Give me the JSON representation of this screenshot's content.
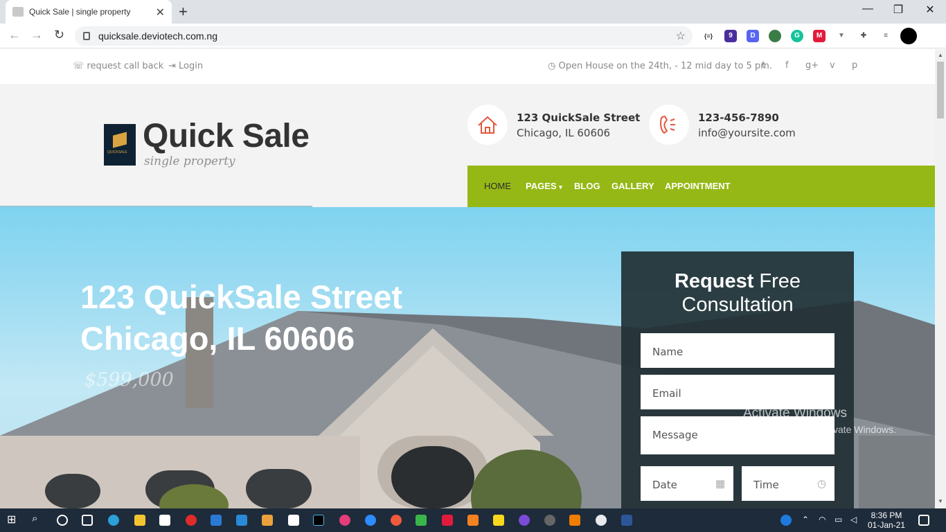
{
  "browser": {
    "tab_title": "Quick Sale | single property",
    "url": "quicksale.deviotech.com.ng",
    "extension_badge": "9"
  },
  "topbar": {
    "callback": "request call back",
    "login": "Login",
    "open_house": "Open House on the 24th, - 12 mid day to 5 pm.",
    "social": [
      "twitter-icon",
      "facebook-icon",
      "google-plus-icon",
      "vimeo-icon",
      "pinterest-icon"
    ],
    "social_glyphs": [
      "t",
      "f",
      "g+",
      "v",
      "p"
    ]
  },
  "header": {
    "logo_small": "QUICKSALE",
    "title": "Quick Sale",
    "tagline": "single property",
    "address_line1": "123 QuickSale Street",
    "address_line2": "Chicago, IL 60606",
    "phone": "123-456-7890",
    "email": "info@yoursite.com"
  },
  "nav": {
    "items": [
      "HOME",
      "PAGES",
      "BLOG",
      "GALLERY",
      "APPOINTMENT"
    ]
  },
  "hero": {
    "title_line1": "123 QuickSale Street",
    "title_line2": "Chicago, IL 60606",
    "price": "$599,000"
  },
  "form": {
    "title_bold": "Request",
    "title_rest": " Free",
    "title_line2": "Consultation",
    "name_placeholder": "Name",
    "email_placeholder": "Email",
    "message_placeholder": "Message",
    "date_placeholder": "Date",
    "time_placeholder": "Time"
  },
  "watermark": {
    "line1": "Activate Windows",
    "line2": "Go to Settings to activate Windows."
  },
  "taskbar": {
    "time": "8:36 PM",
    "date": "01-Jan-21"
  },
  "colors": {
    "nav_green": "#96b816",
    "form_bg": "#213034",
    "accent_red": "#e2573f"
  }
}
